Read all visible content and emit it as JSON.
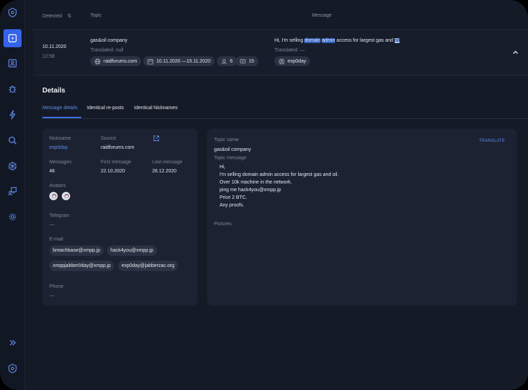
{
  "table": {
    "headers": {
      "detected": "Detected",
      "topic": "Topic",
      "message": "Message"
    },
    "row": {
      "date": "10.11.2020",
      "time": "12:58",
      "topic_title": "gas&oil company",
      "topic_translated": "Translated: null",
      "source_chip": "raidforums.com",
      "date_range_chip": "10.11.2020 —15.11.2020",
      "users_count": "6",
      "messages_count": "15",
      "message_parts": [
        "Hi, I'm selling ",
        "domain",
        " ",
        "admin",
        " access for largest gas and ",
        "oil",
        "."
      ],
      "message_translated": "Translated: —",
      "author_chip": "exp0day"
    }
  },
  "details": {
    "title": "Details",
    "tabs": [
      "Message details",
      "Identical re-posts",
      "Identical Nicknames"
    ],
    "left": {
      "nickname_label": "Nickname",
      "nickname": "exp0day",
      "source_label": "Source",
      "source": "raidforums.com",
      "messages_label": "Messages",
      "messages": "48",
      "first_message_label": "First message",
      "first_message": "22.10.2020",
      "last_message_label": "Last message",
      "last_message": "28.12.2020",
      "avatars_label": "Avatars",
      "telegram_label": "Telegram",
      "telegram": "—",
      "email_label": "E-mail",
      "emails": [
        "breachbase@xmpp.jp",
        "hack4you@xmpp.jp",
        "xmppjabber0day@xmpp.jp",
        "exp0day@jabberzac.org"
      ],
      "phone_label": "Phone",
      "phone": "—"
    },
    "right": {
      "topic_name_label": "Topic name",
      "topic_name": "gas&oil company",
      "translate_label": "TRANSLATE",
      "topic_message_label": "Topic message",
      "message_lines": [
        "Hi,",
        "I'm selling domain admin access for largest gas and oil.",
        "Over 10k machine in the network.",
        "ping me hack4you@xmpp.jp",
        "Price 2 BTC.",
        "Any proofs."
      ],
      "pictures_label": "Pictures"
    }
  },
  "colors": {
    "accent": "#3563e9",
    "link": "#5f8df0",
    "background": "#151a27"
  }
}
